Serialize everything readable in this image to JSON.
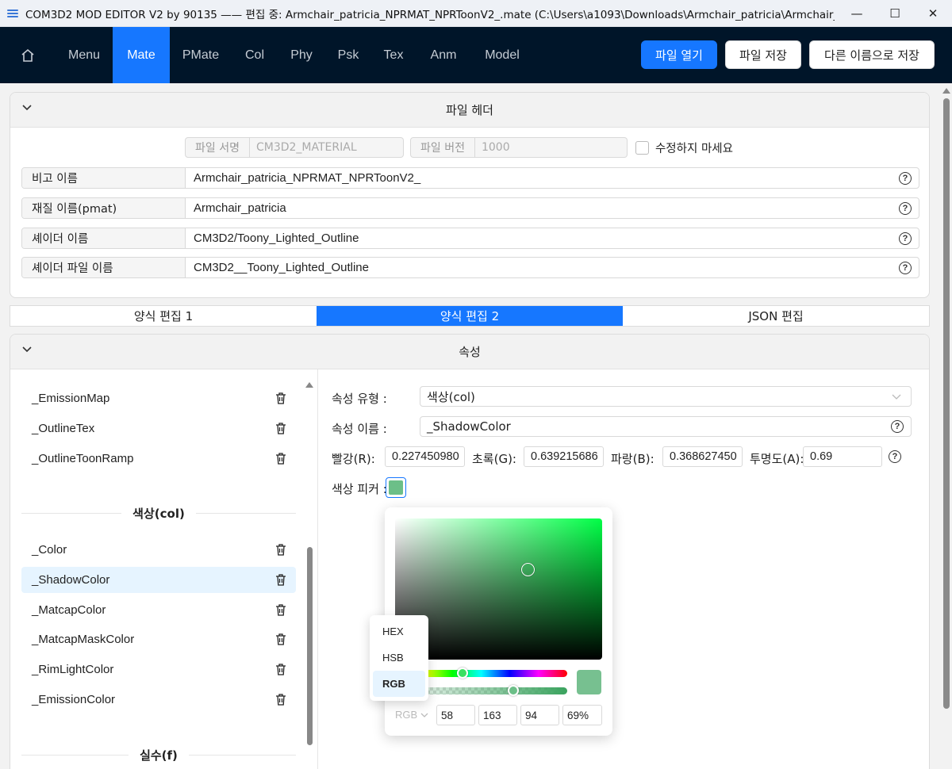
{
  "window": {
    "title": "COM3D2 MOD EDITOR V2 by 90135 —— 편집 중: Armchair_patricia_NPRMAT_NPRToonV2_.mate  (C:\\Users\\a1093\\Downloads\\Armchair_patricia\\Armchair_patricia_NPRM..."
  },
  "nav": {
    "items": [
      "Menu",
      "Mate",
      "PMate",
      "Col",
      "Phy",
      "Psk",
      "Tex",
      "Anm",
      "Model"
    ],
    "active": "Mate",
    "open_label": "파일 열기",
    "save_label": "파일 저장",
    "save_as_label": "다른 이름으로 저장"
  },
  "header_panel": {
    "title": "파일 헤더",
    "signature_label": "파일 서명",
    "signature_value": "CM3D2_MATERIAL",
    "version_label": "파일 버전",
    "version_value": "1000",
    "readonly_label": "수정하지 마세요",
    "fields": [
      {
        "label": "비고 이름",
        "value": "Armchair_patricia_NPRMAT_NPRToonV2_"
      },
      {
        "label": "재질 이름(pmat)",
        "value": "Armchair_patricia"
      },
      {
        "label": "셰이더 이름",
        "value": "CM3D2/Toony_Lighted_Outline"
      },
      {
        "label": "셰이더 파일 이름",
        "value": "CM3D2__Toony_Lighted_Outline"
      }
    ]
  },
  "tabs": [
    "양식 편집 1",
    "양식 편집 2",
    "JSON 편집"
  ],
  "props_panel": {
    "title": "속성",
    "tex_items": [
      "_EmissionMap",
      "_OutlineTex",
      "_OutlineToonRamp"
    ],
    "col_group": "색상(col)",
    "col_items": [
      "_Color",
      "_ShadowColor",
      "_MatcapColor",
      "_MatcapMaskColor",
      "_RimLightColor",
      "_EmissionColor"
    ],
    "float_group": "실수(f)",
    "selected": "_ShadowColor"
  },
  "editor": {
    "type_label": "속성 유형 :",
    "type_value": "색상(col)",
    "name_label": "속성 이름 :",
    "name_value": "_ShadowColor",
    "r_label": "빨강(R):",
    "r_value": "0.227450980",
    "g_label": "초록(G):",
    "g_value": "0.639215686",
    "b_label": "파랑(B):",
    "b_value": "0.368627450",
    "a_label": "투명도(A):",
    "a_value": "0.69",
    "picker_label": "색상 피커 :",
    "swatch_color": "#3aa35e"
  },
  "picker": {
    "format": "RGB",
    "r": "58",
    "g": "163",
    "b": "94",
    "a": "69%",
    "format_options": [
      "HEX",
      "HSB",
      "RGB"
    ],
    "format_selected": "RGB"
  }
}
